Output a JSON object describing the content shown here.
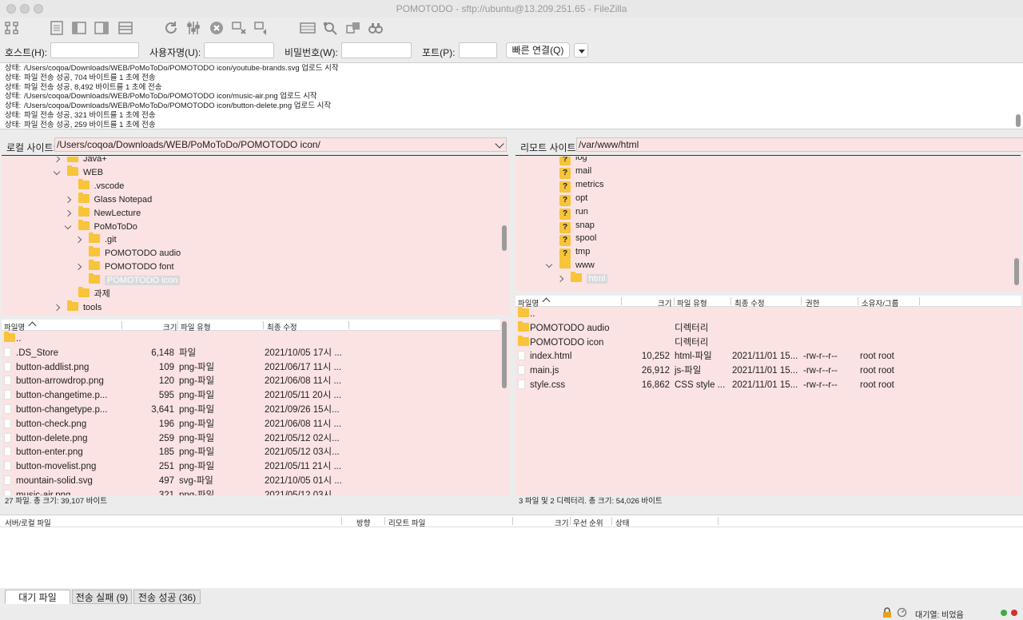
{
  "window": {
    "title": "POMOTODO - sftp://ubuntu@13.209.251.65 - FileZilla"
  },
  "toolbar": {
    "icons": [
      "site-manager-icon",
      "toggle-log-icon",
      "toggle-local-tree-icon",
      "toggle-remote-tree-icon",
      "toggle-queue-icon",
      "refresh-icon",
      "process-queue-icon",
      "cancel-icon",
      "disconnect-icon",
      "reconnect-icon",
      "directory-compare-icon",
      "filter-icon",
      "sync-browse-icon",
      "search-icon"
    ]
  },
  "quickconnect": {
    "host_label": "호스트(H):",
    "user_label": "사용자명(U):",
    "pass_label": "비밀번호(W):",
    "port_label": "포트(P):",
    "host_value": "",
    "user_value": "",
    "pass_value": "",
    "port_value": "",
    "connect_label": "빠른 연결(Q)"
  },
  "log": [
    {
      "prefix": "상태:",
      "text": "/Users/coqoa/Downloads/WEB/PoMoToDo/POMOTODO icon/youtube-brands.svg 업로드 시작"
    },
    {
      "prefix": "상태:",
      "text": "파일 전송 성공, 704 바이트를 1 초에 전송"
    },
    {
      "prefix": "상태:",
      "text": "파일 전송 성공, 8,492 바이트를 1 초에 전송"
    },
    {
      "prefix": "상태:",
      "text": "/Users/coqoa/Downloads/WEB/PoMoToDo/POMOTODO icon/music-air.png 업로드 시작"
    },
    {
      "prefix": "상태:",
      "text": "/Users/coqoa/Downloads/WEB/PoMoToDo/POMOTODO icon/button-delete.png 업로드 시작"
    },
    {
      "prefix": "상태:",
      "text": "파일 전송 성공, 321 바이트를 1 초에 전송"
    },
    {
      "prefix": "상태:",
      "text": "파일 전송 성공, 259 바이트를 1 초에 전송"
    }
  ],
  "local": {
    "site_label": "로컬 사이트:",
    "path": "/Users/coqoa/Downloads/WEB/PoMoToDo/POMOTODO icon/",
    "tree": [
      {
        "name": "Java+",
        "depth": 0,
        "chev": "right"
      },
      {
        "name": "WEB",
        "depth": 0,
        "chev": "down"
      },
      {
        "name": ".vscode",
        "depth": 1,
        "chev": ""
      },
      {
        "name": "Glass Notepad",
        "depth": 1,
        "chev": "right"
      },
      {
        "name": "NewLecture",
        "depth": 1,
        "chev": "right"
      },
      {
        "name": "PoMoToDo",
        "depth": 1,
        "chev": "down"
      },
      {
        "name": ".git",
        "depth": 2,
        "chev": "right"
      },
      {
        "name": "POMOTODO audio",
        "depth": 2,
        "chev": ""
      },
      {
        "name": "POMOTODO font",
        "depth": 2,
        "chev": "right"
      },
      {
        "name": "POMOTODO icon",
        "depth": 2,
        "chev": "",
        "selected": true
      },
      {
        "name": "과제",
        "depth": 1,
        "chev": ""
      },
      {
        "name": "tools",
        "depth": 0,
        "chev": "right"
      }
    ],
    "headers": {
      "name": "파일명",
      "size": "크기",
      "type": "파일 유형",
      "modified": "최종 수정"
    },
    "files": [
      {
        "name": "..",
        "size": "",
        "type": "",
        "modified": "",
        "folder": true
      },
      {
        "name": ".DS_Store",
        "size": "6,148",
        "type": "파일",
        "modified": "2021/10/05 17시 ..."
      },
      {
        "name": "button-addlist.png",
        "size": "109",
        "type": "png-파일",
        "modified": "2021/06/17 11시 ..."
      },
      {
        "name": "button-arrowdrop.png",
        "size": "120",
        "type": "png-파일",
        "modified": "2021/06/08 11시 ..."
      },
      {
        "name": "button-changetime.p...",
        "size": "595",
        "type": "png-파일",
        "modified": "2021/05/11 20시 ..."
      },
      {
        "name": "button-changetype.p...",
        "size": "3,641",
        "type": "png-파일",
        "modified": "2021/09/26 15시..."
      },
      {
        "name": "button-check.png",
        "size": "196",
        "type": "png-파일",
        "modified": "2021/06/08 11시 ..."
      },
      {
        "name": "button-delete.png",
        "size": "259",
        "type": "png-파일",
        "modified": "2021/05/12 02시..."
      },
      {
        "name": "button-enter.png",
        "size": "185",
        "type": "png-파일",
        "modified": "2021/05/12 03시..."
      },
      {
        "name": "button-movelist.png",
        "size": "251",
        "type": "png-파일",
        "modified": "2021/05/11 21시 ..."
      },
      {
        "name": "mountain-solid.svg",
        "size": "497",
        "type": "svg-파일",
        "modified": "2021/10/05 01시 ..."
      },
      {
        "name": "music-air.png",
        "size": "321",
        "type": "png-파일",
        "modified": "2021/05/12 03시..."
      }
    ],
    "status": "27 파일. 총 크기: 39,107 바이트"
  },
  "remote": {
    "site_label": "리모트 사이트:",
    "path": "/var/www/html",
    "tree": [
      {
        "name": "log",
        "depth": 0,
        "chev": "",
        "unknown": true
      },
      {
        "name": "mail",
        "depth": 0,
        "chev": "",
        "unknown": true
      },
      {
        "name": "metrics",
        "depth": 0,
        "chev": "",
        "unknown": true
      },
      {
        "name": "opt",
        "depth": 0,
        "chev": "",
        "unknown": true
      },
      {
        "name": "run",
        "depth": 0,
        "chev": "",
        "unknown": true
      },
      {
        "name": "snap",
        "depth": 0,
        "chev": "",
        "unknown": true
      },
      {
        "name": "spool",
        "depth": 0,
        "chev": "",
        "unknown": true
      },
      {
        "name": "tmp",
        "depth": 0,
        "chev": "",
        "unknown": true
      },
      {
        "name": "www",
        "depth": 0,
        "chev": "down"
      },
      {
        "name": "html",
        "depth": 1,
        "chev": "right",
        "selected": true
      }
    ],
    "headers": {
      "name": "파일명",
      "size": "크기",
      "type": "파일 유형",
      "modified": "최종 수정",
      "perm": "권한",
      "owner": "소유자/그룹"
    },
    "files": [
      {
        "name": "..",
        "size": "",
        "type": "",
        "modified": "",
        "perm": "",
        "owner": "",
        "folder": true
      },
      {
        "name": "POMOTODO audio",
        "size": "",
        "type": "디렉터리",
        "modified": "",
        "perm": "",
        "owner": "",
        "folder": true
      },
      {
        "name": "POMOTODO icon",
        "size": "",
        "type": "디렉터리",
        "modified": "",
        "perm": "",
        "owner": "",
        "folder": true
      },
      {
        "name": "index.html",
        "size": "10,252",
        "type": "html-파일",
        "modified": "2021/11/01 15...",
        "perm": "-rw-r--r--",
        "owner": "root root"
      },
      {
        "name": "main.js",
        "size": "26,912",
        "type": "js-파일",
        "modified": "2021/11/01 15...",
        "perm": "-rw-r--r--",
        "owner": "root root"
      },
      {
        "name": "style.css",
        "size": "16,862",
        "type": "CSS style ...",
        "modified": "2021/11/01 15...",
        "perm": "-rw-r--r--",
        "owner": "root root"
      }
    ],
    "status": "3 파일 및 2 디렉터리. 총 크기: 54,026 바이트"
  },
  "queue": {
    "headers": {
      "server": "서버/로컬 파일",
      "direction": "방향",
      "remote": "리모트 파일",
      "size": "크기",
      "priority": "우선 순위",
      "status": "상태"
    },
    "tabs": [
      "대기 파일",
      "전송 실패 (9)",
      "전송 성공 (36)"
    ],
    "status": "대기열: 비었음"
  }
}
